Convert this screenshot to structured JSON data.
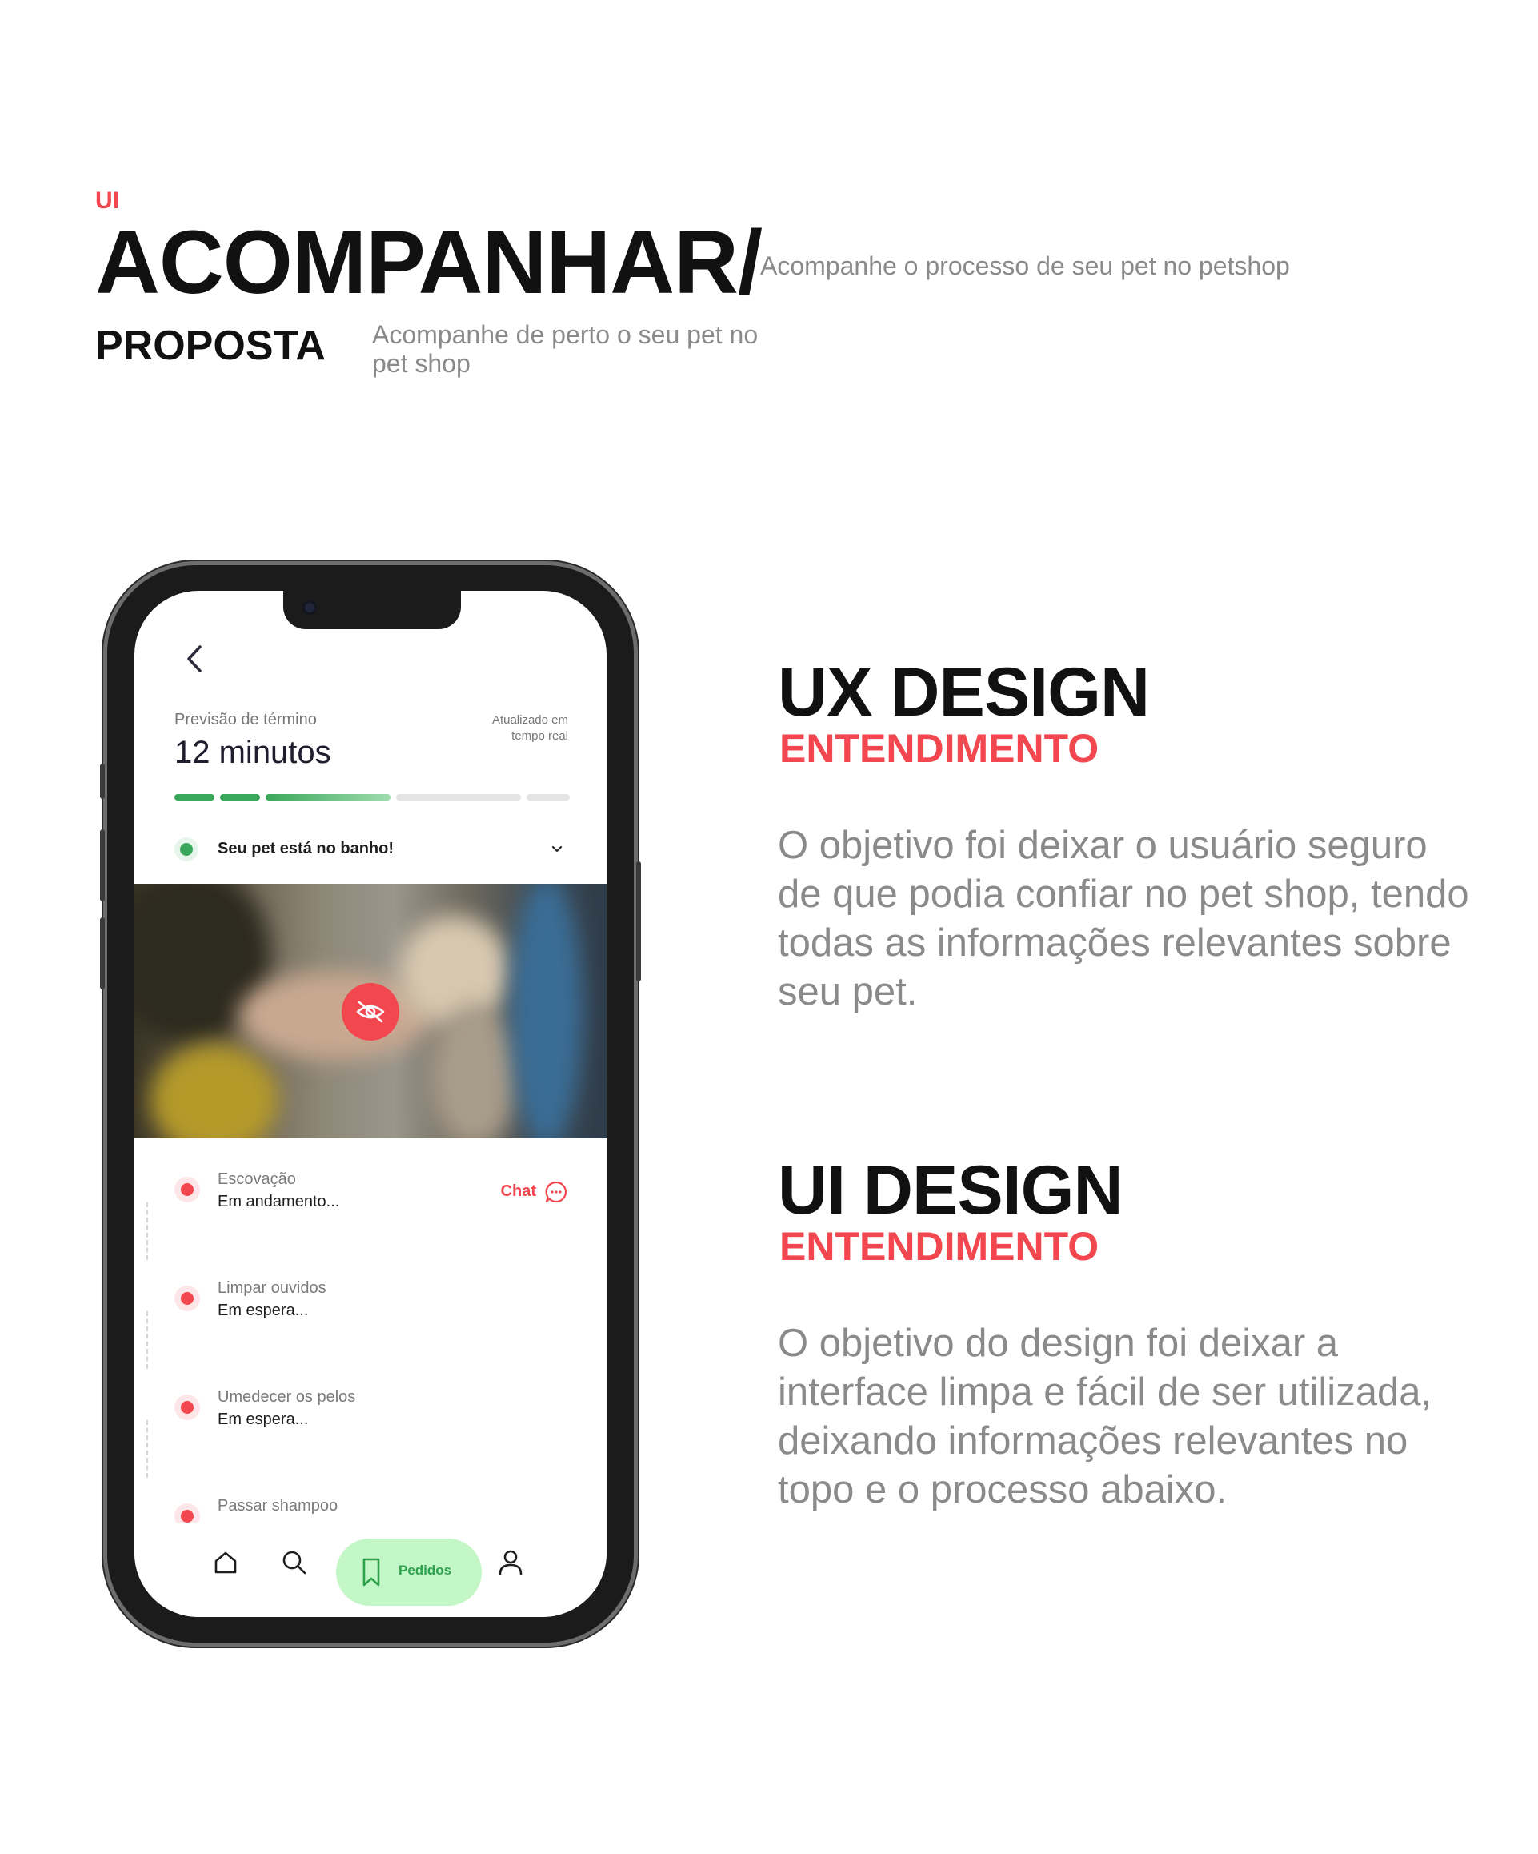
{
  "header": {
    "tag": "UI",
    "title": "ACOMPANHAR/",
    "subtitle": "Acompanhe o processo de seu pet no petshop",
    "proposta_label": "PROPOSTA",
    "proposta_desc": "Acompanhe de perto o seu pet no pet shop"
  },
  "sections": {
    "ux": {
      "title": "UX DESIGN",
      "subtitle": "ENTENDIMENTO",
      "body": "O objetivo foi deixar o usuário seguro de que podia confiar no pet shop, tendo todas as informações relevantes sobre seu pet."
    },
    "ui": {
      "title": "UI DESIGN",
      "subtitle": "ENTENDIMENTO",
      "body": "O objetivo do design foi deixar a interface limpa e fácil de ser utilizada, deixando informações relevantes no topo e o processo abaixo."
    }
  },
  "app": {
    "eta_label": "Previsão de término",
    "eta_value": "12 minutos",
    "realtime_note": "Atualizado em tempo real",
    "progress": {
      "segments_total": 5,
      "segments_done": 3
    },
    "status_text": "Seu pet está no banho!",
    "chat_label": "Chat",
    "steps": [
      {
        "name": "Escovação",
        "state": "Em andamento..."
      },
      {
        "name": "Limpar ouvidos",
        "state": "Em espera..."
      },
      {
        "name": "Umedecer os pelos",
        "state": "Em espera..."
      },
      {
        "name": "Passar shampoo",
        "state": ""
      }
    ],
    "tabbar": {
      "active_label": "Pedidos",
      "items": [
        "home-icon",
        "search-icon",
        "bookmark-icon",
        "user-icon"
      ]
    },
    "colors": {
      "accent_red": "#f2474f",
      "accent_green": "#3aa85a",
      "pill_green": "#c4f7c8"
    }
  }
}
